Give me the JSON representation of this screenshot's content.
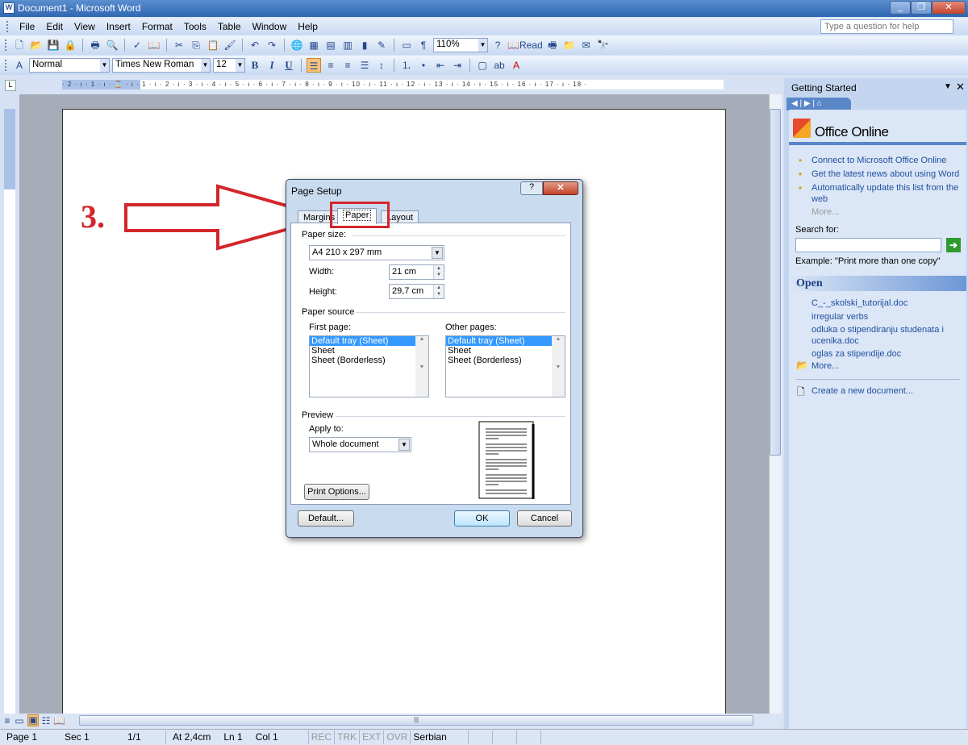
{
  "window": {
    "title": "Document1 - Microsoft Word",
    "help_placeholder": "Type a question for help"
  },
  "menu": [
    "File",
    "Edit",
    "View",
    "Insert",
    "Format",
    "Tools",
    "Table",
    "Window",
    "Help"
  ],
  "toolbar": {
    "zoom": "110%",
    "read_label": "Read"
  },
  "formatting": {
    "style": "Normal",
    "font": "Times New Roman",
    "size": "12",
    "bold": "B",
    "italic": "I",
    "underline": "U"
  },
  "ruler": {
    "text": "· 2 · ı · 1 · ı · ⌛ · ı · 1 · ı · 2 · ı · 3 · ı · 4 · ı · 5 · ı · 6 · ı · 7 · ı · 8 · ı · 9 · ı · 10 · ı · 11 · ı · 12 · ı · 13 · ı · 14 · ı · 15 · ı · 16 · ı · 17 · ı · 18 ·"
  },
  "annotation": {
    "step": "3."
  },
  "dialog": {
    "title": "Page Setup",
    "tabs": [
      "Margins",
      "Paper",
      "Layout"
    ],
    "active_tab": "Paper",
    "paper_size_label": "Paper size:",
    "paper_size": "A4 210 x 297 mm",
    "width_label": "Width:",
    "width": "21 cm",
    "height_label": "Height:",
    "height": "29,7 cm",
    "paper_source_label": "Paper source",
    "first_page_label": "First page:",
    "other_pages_label": "Other pages:",
    "trays": [
      "Default tray (Sheet)",
      "Sheet",
      "Sheet (Borderless)"
    ],
    "preview_label": "Preview",
    "apply_to_label": "Apply to:",
    "apply_to": "Whole document",
    "print_options": "Print Options...",
    "default": "Default...",
    "ok": "OK",
    "cancel": "Cancel"
  },
  "taskpane": {
    "title": "Getting Started",
    "logo": "Office Online",
    "links": [
      "Connect to Microsoft Office Online",
      "Get the latest news about using Word",
      "Automatically update this list from the web"
    ],
    "more1": "More...",
    "search_label": "Search for:",
    "example": "Example:  \"Print more than one copy\"",
    "open_title": "Open",
    "files": [
      "C_-_skolski_tutorijal.doc",
      "irregular verbs",
      "odluka o stipendiranju studenata i ucenika.doc",
      "oglas za stipendije.doc"
    ],
    "more2": "More...",
    "create": "Create a new document..."
  },
  "status": {
    "page": "Page 1",
    "sec": "Sec 1",
    "pages": "1/1",
    "at": "At 2,4cm",
    "ln": "Ln 1",
    "col": "Col 1",
    "rec": "REC",
    "trk": "TRK",
    "ext": "EXT",
    "ovr": "OVR",
    "lang": "Serbian (Lati"
  }
}
